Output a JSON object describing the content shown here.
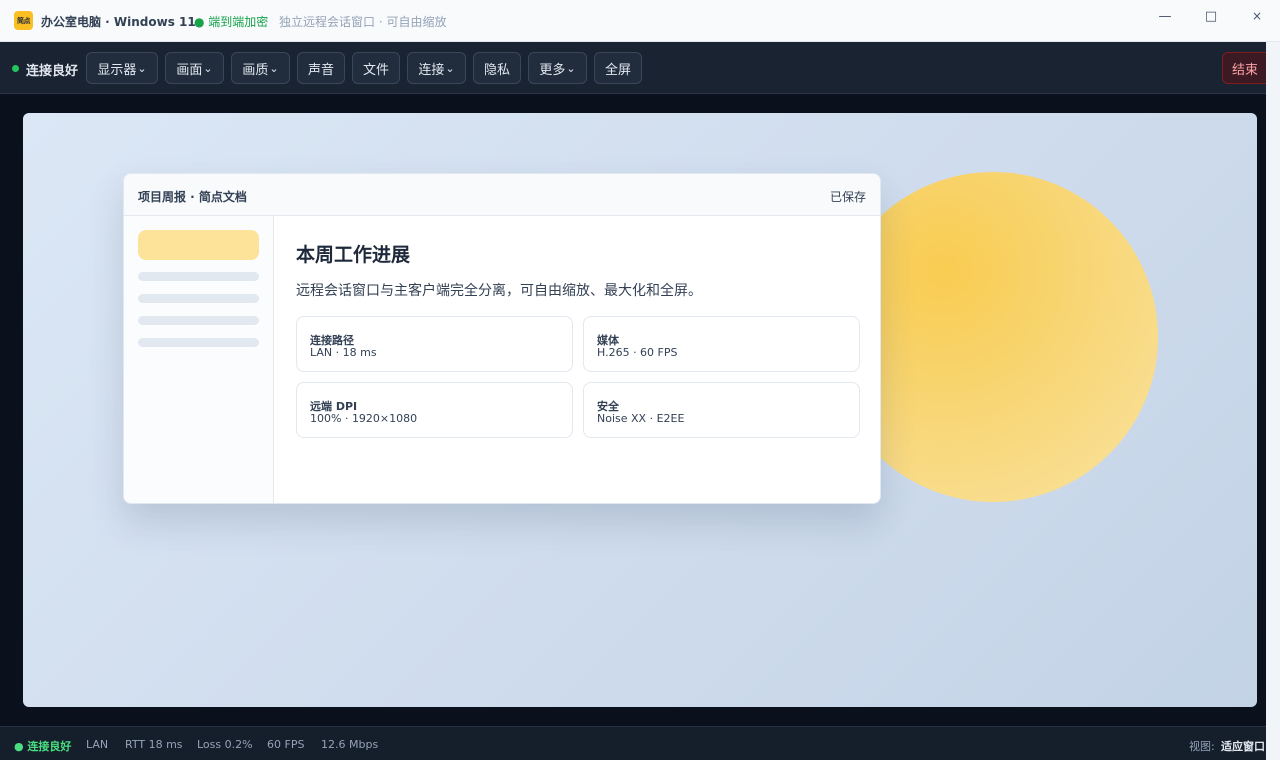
{
  "titlebar": {
    "logo_text": "简点",
    "title": "办公室电脑 · Windows 11",
    "encryption": "● 端到端加密",
    "subtitle": "独立远程会话窗口 · 可自由缩放",
    "minimize": "—",
    "maximize": "□",
    "close": "×"
  },
  "toolbar": {
    "status": "连接良好",
    "buttons": {
      "display": "显示器",
      "screen": "画面",
      "quality": "画质",
      "audio": "声音",
      "files": "文件",
      "connect": "连接",
      "privacy": "隐私",
      "more": "更多",
      "fullscreen": "全屏"
    },
    "dropdown_glyph": "⌄",
    "end": "结束"
  },
  "document": {
    "window_title": "项目周报 · 简点文档",
    "saved_status": "已保存",
    "heading": "本周工作进展",
    "paragraph": "远程会话窗口与主客户端完全分离，可自由缩放、最大化和全屏。",
    "cards": [
      {
        "label": "连接路径",
        "value": "LAN · 18 ms"
      },
      {
        "label": "媒体",
        "value": "H.265 · 60 FPS"
      },
      {
        "label": "远端 DPI",
        "value": "100% · 1920×1080"
      },
      {
        "label": "安全",
        "value": "Noise XX · E2EE"
      }
    ]
  },
  "statusbar": {
    "connection": "● 连接良好",
    "network": "LAN",
    "rtt": "RTT 18 ms",
    "loss": "Loss 0.2%",
    "fps": "60 FPS",
    "bitrate": "12.6 Mbps",
    "view_label": "视图:",
    "view_value": "适应窗口"
  },
  "colors": {
    "accent_yellow": "#fbbf24",
    "status_green": "#22c55e",
    "end_button_red": "#fca5a5",
    "toolbar_bg": "#1a2332"
  }
}
